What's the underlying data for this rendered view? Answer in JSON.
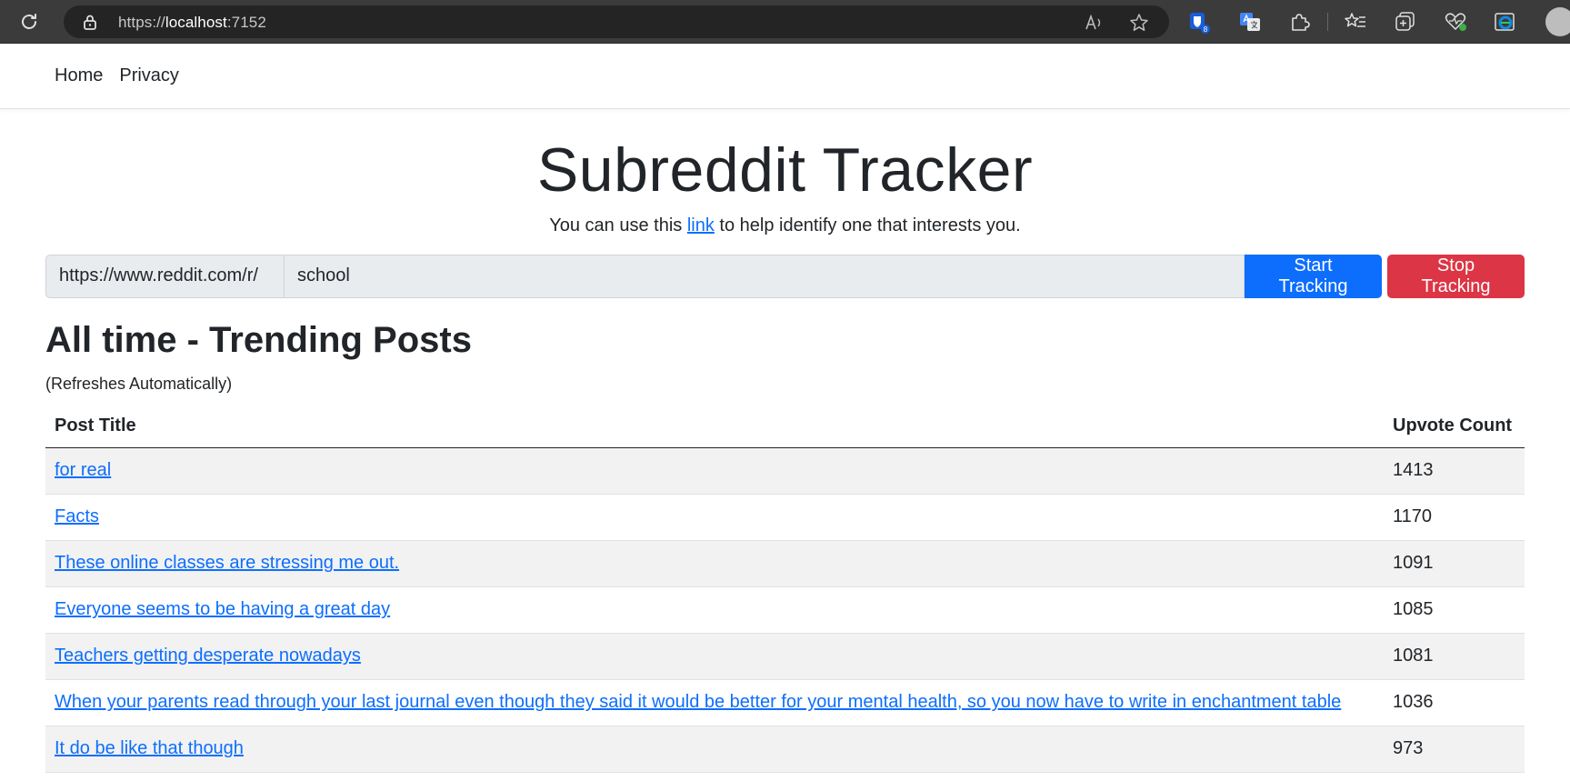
{
  "browser": {
    "url_scheme": "https://",
    "url_host": "localhost",
    "url_port": ":7152",
    "extension_badge": "8"
  },
  "nav": {
    "home": "Home",
    "privacy": "Privacy"
  },
  "page": {
    "title": "Subreddit Tracker",
    "lead_before": "You can use this ",
    "lead_link": "link",
    "lead_after": " to help identify one that interests you."
  },
  "tracker": {
    "prefix": "https://www.reddit.com/r/",
    "value": "school",
    "start_label": "Start Tracking",
    "stop_label": "Stop Tracking"
  },
  "section": {
    "heading": "All time - Trending Posts",
    "subtitle": "(Refreshes Automatically)"
  },
  "table": {
    "headers": [
      "Post Title",
      "Upvote Count"
    ],
    "rows": [
      {
        "title": "for real",
        "upvotes": "1413"
      },
      {
        "title": "Facts",
        "upvotes": "1170"
      },
      {
        "title": "These online classes are stressing me out.",
        "upvotes": "1091"
      },
      {
        "title": "Everyone seems to be having a great day",
        "upvotes": "1085"
      },
      {
        "title": "Teachers getting desperate nowadays",
        "upvotes": "1081"
      },
      {
        "title": "When your parents read through your last journal even though they said it would be better for your mental health, so you now have to write in enchantment table",
        "upvotes": "1036"
      },
      {
        "title": "It do be like that though",
        "upvotes": "973"
      }
    ]
  },
  "colors": {
    "primary": "#0d6efd",
    "danger": "#dc3545",
    "input_bg": "#e9ecef",
    "stripe": "#f2f2f2"
  }
}
